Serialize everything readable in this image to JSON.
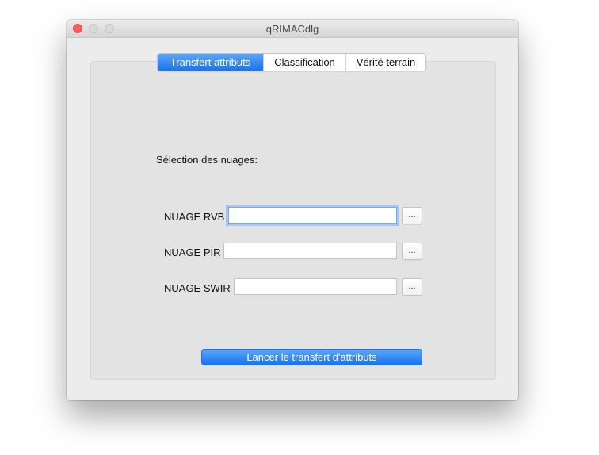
{
  "window": {
    "title": "qRIMACdlg"
  },
  "tabs": [
    {
      "label": "Transfert attributs",
      "active": true
    },
    {
      "label": "Classification",
      "active": false
    },
    {
      "label": "Vérité terrain",
      "active": false
    }
  ],
  "form": {
    "section_label": "Sélection des nuages:",
    "fields": [
      {
        "label": "NUAGE RVB",
        "value": "",
        "browse_label": "..."
      },
      {
        "label": "NUAGE PIR",
        "value": "",
        "browse_label": "..."
      },
      {
        "label": "NUAGE SWIR",
        "value": "",
        "browse_label": "..."
      }
    ],
    "submit_label": "Lancer le transfert d'attributs"
  },
  "colors": {
    "accent": "#1a73ef",
    "close_button": "#fc5f57"
  },
  "icons": {
    "close": "close-icon",
    "minimize": "minimize-icon",
    "maximize": "maximize-icon"
  }
}
